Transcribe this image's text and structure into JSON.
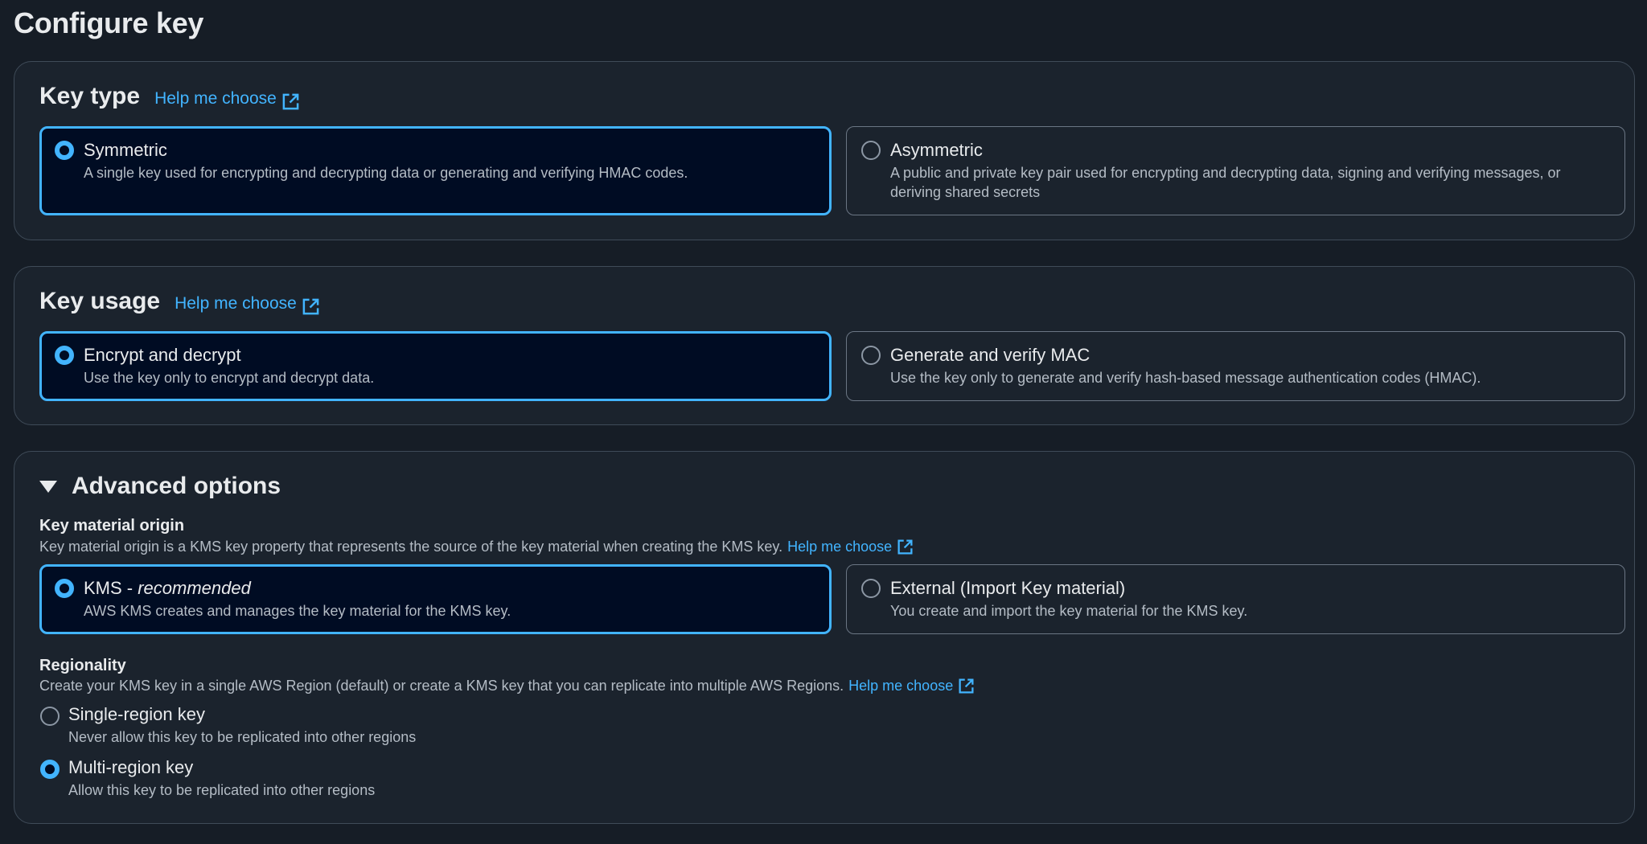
{
  "page": {
    "title": "Configure key"
  },
  "key_type": {
    "heading": "Key type",
    "help_link": "Help me choose",
    "options": [
      {
        "title": "Symmetric",
        "description": "A single key used for encrypting and decrypting data or generating and verifying HMAC codes.",
        "selected": true
      },
      {
        "title": "Asymmetric",
        "description": "A public and private key pair used for encrypting and decrypting data, signing and verifying messages, or deriving shared secrets",
        "selected": false
      }
    ]
  },
  "key_usage": {
    "heading": "Key usage",
    "help_link": "Help me choose",
    "options": [
      {
        "title": "Encrypt and decrypt",
        "description": "Use the key only to encrypt and decrypt data.",
        "selected": true
      },
      {
        "title": "Generate and verify MAC",
        "description": "Use the key only to generate and verify hash-based message authentication codes (HMAC).",
        "selected": false
      }
    ]
  },
  "advanced": {
    "heading": "Advanced options",
    "expanded": true,
    "key_material_origin": {
      "label": "Key material origin",
      "description": "Key material origin is a KMS key property that represents the source of the key material when creating the KMS key.",
      "help_link": "Help me choose",
      "options": [
        {
          "title_prefix": "KMS - ",
          "title_emphasis": "recommended",
          "description": "AWS KMS creates and manages the key material for the KMS key.",
          "selected": true
        },
        {
          "title": "External (Import Key material)",
          "description": "You create and import the key material for the KMS key.",
          "selected": false
        }
      ]
    },
    "regionality": {
      "label": "Regionality",
      "description": "Create your KMS key in a single AWS Region (default) or create a KMS key that you can replicate into multiple AWS Regions.",
      "help_link": "Help me choose",
      "options": [
        {
          "title": "Single-region key",
          "description": "Never allow this key to be replicated into other regions",
          "selected": false
        },
        {
          "title": "Multi-region key",
          "description": "Allow this key to be replicated into other regions",
          "selected": true
        }
      ]
    }
  },
  "colors": {
    "accent": "#42b4ff",
    "background": "#161d26",
    "container": "#1b232d",
    "selected_tile": "#000c23"
  },
  "icons": {
    "external_link": "external-link-icon",
    "caret": "caret-down-icon"
  }
}
